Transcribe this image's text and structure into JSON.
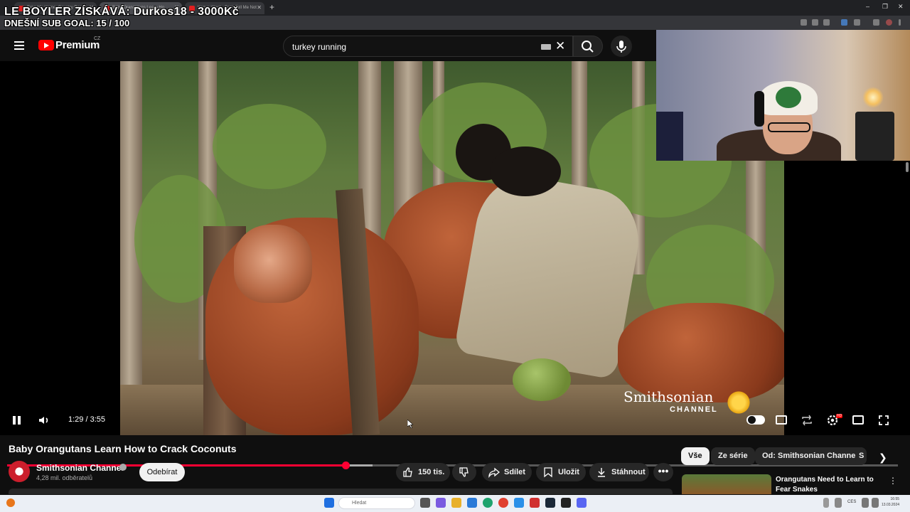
{
  "browser": {
    "tabs": [
      {
        "label": "Take Me Home, Country Roads"
      },
      {
        "label": "Baby Orangutans Learn Ho"
      },
      {
        "label": "Kanye West - Can't Tell Me Not"
      }
    ],
    "new_tab_label": "+",
    "window_controls": [
      "–",
      "❐",
      "✕"
    ]
  },
  "overlay": {
    "line1": "LE BOYLER ZÍSKÁVÁ: Durkos18 - 3000Kč",
    "line2": "DNEŠNÍ SUB GOAL:  15 / 100"
  },
  "youtube": {
    "logo_text": "Premium",
    "country": "CZ",
    "search_value": "turkey running"
  },
  "player": {
    "brand_name": "Smithsonian",
    "brand_sub": "CHANNEL",
    "time_current": "1:29",
    "time_total": "3:55",
    "time_display": "1:29 / 3:55",
    "played_fraction": 0.38,
    "buffered_fraction": 0.41,
    "hd_badge": "HD"
  },
  "video": {
    "title": "Baby Orangutans Learn How to Crack Coconuts",
    "channel_name": "Smithsonian Channel",
    "subscribers": "4,28 mil. odběratelů",
    "subscribe_label": "Odebírat",
    "like_count": "150 tis.",
    "share_label": "Sdílet",
    "save_label": "Uložit",
    "download_label": "Stáhnout",
    "more_label": "•••"
  },
  "chips": [
    {
      "label": "Vše",
      "active": true
    },
    {
      "label": "Ze série",
      "active": false
    },
    {
      "label": "Od: Smithsonian Channel",
      "active": false
    },
    {
      "label": "S",
      "active": false
    }
  ],
  "related": {
    "title": "Orangutans Need to Learn to Fear Snakes",
    "menu": "⋮"
  },
  "taskbar": {
    "search_placeholder": "Hledat",
    "lang": "CES",
    "time": "16:55",
    "date": "13.03.2024"
  },
  "colors": {
    "accent": "#ff0033",
    "background": "#0f0f0f",
    "pill": "#272727"
  }
}
